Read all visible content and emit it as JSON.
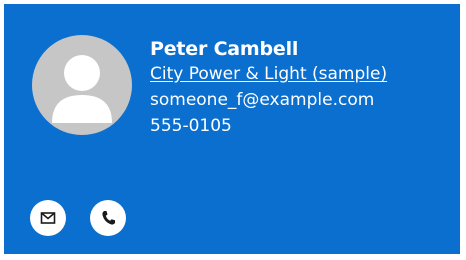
{
  "contact": {
    "name": "Peter Cambell",
    "company": "City Power & Light (sample)",
    "email": "someone_f@example.com",
    "phone": "555-0105"
  },
  "actions": [
    {
      "icon": "mail-icon"
    },
    {
      "icon": "phone-icon"
    }
  ],
  "colors": {
    "card_background": "#0a6fcf",
    "avatar_background": "#c6c6c6",
    "text": "#ffffff"
  }
}
